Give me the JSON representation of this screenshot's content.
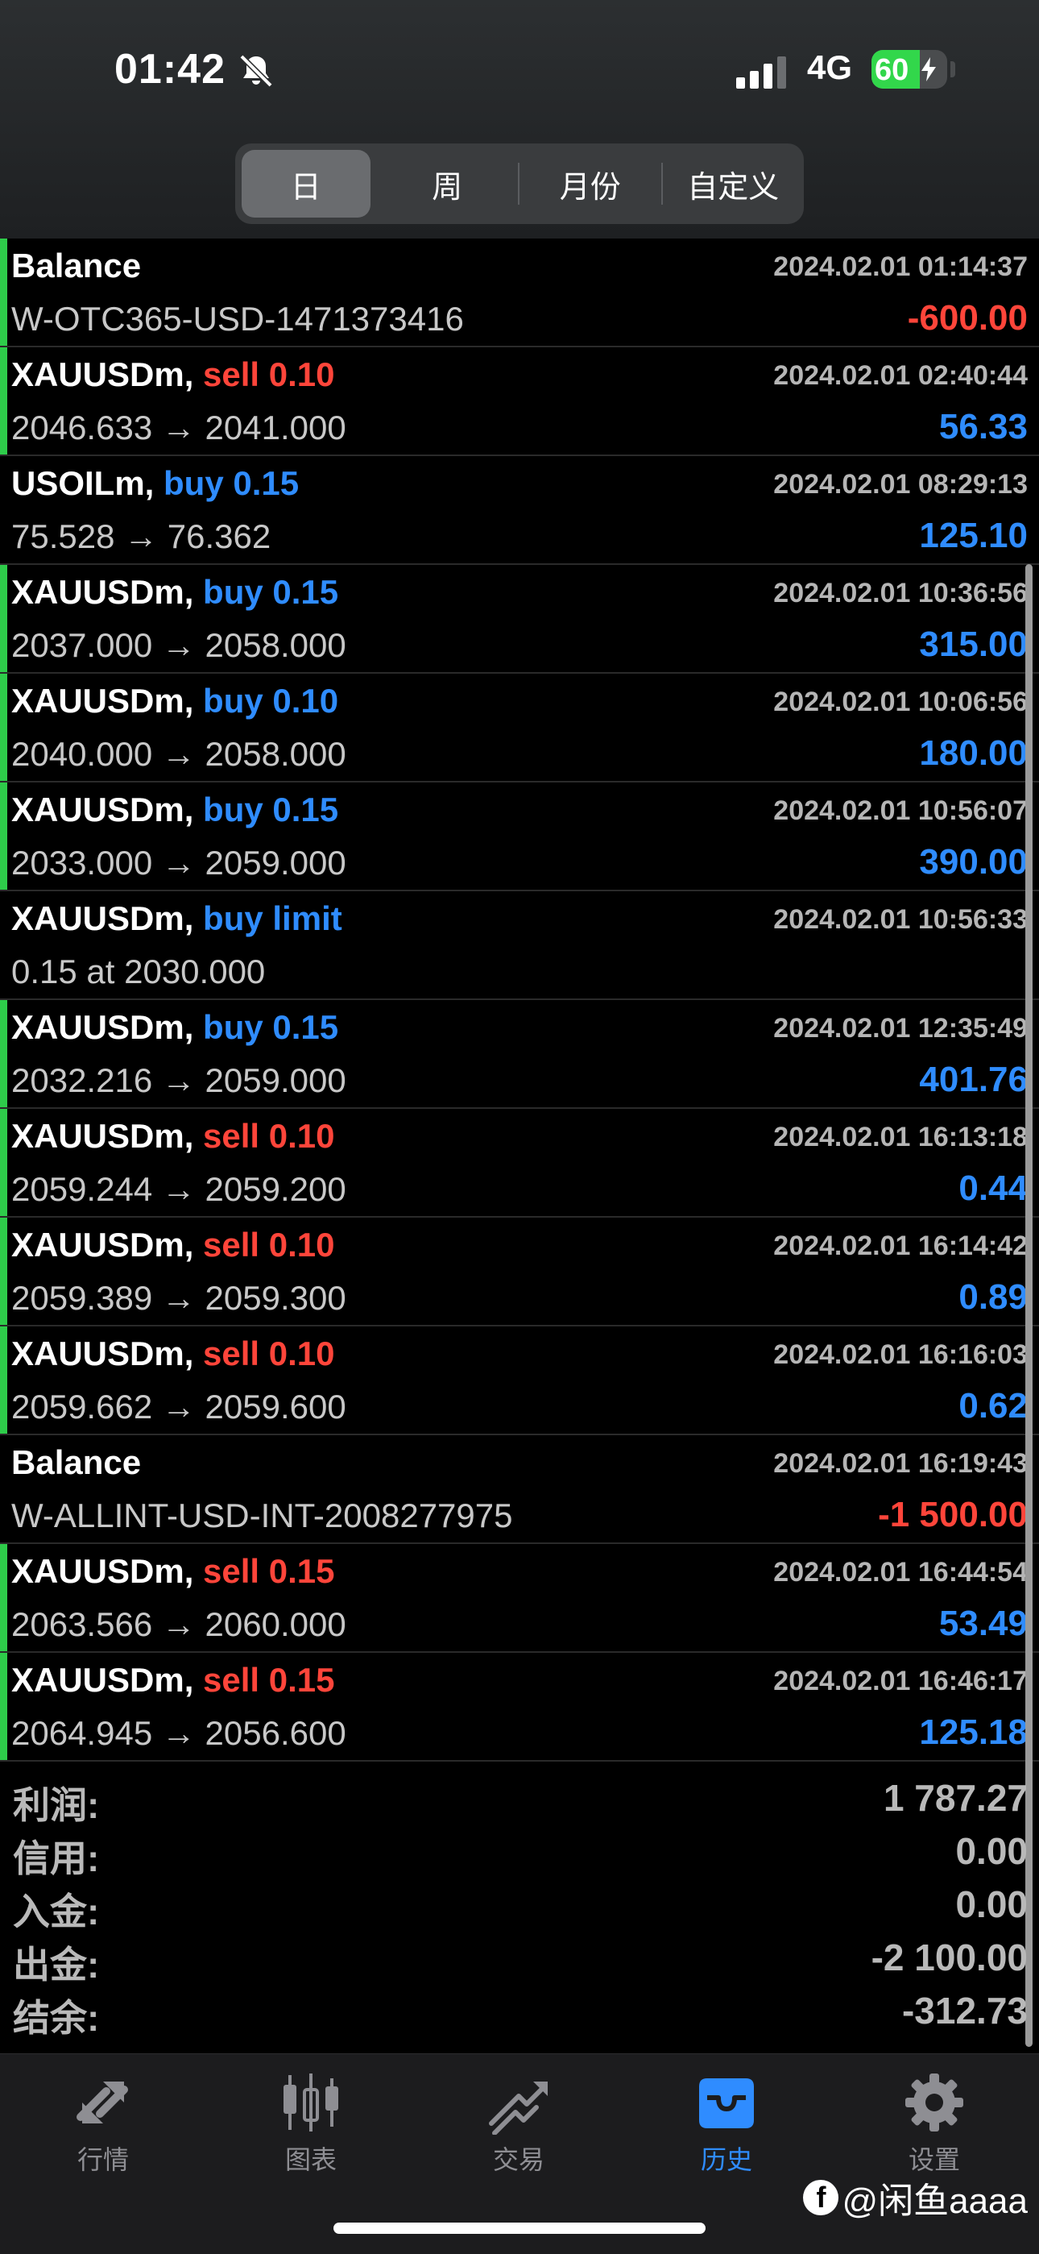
{
  "status": {
    "time": "01:42",
    "network": "4G",
    "battery": "60"
  },
  "segments": [
    {
      "label": "日",
      "active": true
    },
    {
      "label": "周",
      "active": false
    },
    {
      "label": "月份",
      "active": false
    },
    {
      "label": "自定义",
      "active": false
    }
  ],
  "rows": [
    {
      "symbol": "Balance",
      "type": "",
      "dir": "",
      "time": "2024.02.01 01:14:37",
      "sub": "W-OTC365-USD-1471373416",
      "amount": "-600.00",
      "sign": "neg",
      "bar": true
    },
    {
      "symbol": "XAUUSDm,",
      "type": "sell 0.10",
      "dir": "sell",
      "time": "2024.02.01 02:40:44",
      "sub": "2046.633 → 2041.000",
      "amount": "56.33",
      "sign": "pos",
      "bar": true
    },
    {
      "symbol": "USOILm,",
      "type": "buy 0.15",
      "dir": "buy",
      "time": "2024.02.01 08:29:13",
      "sub": "75.528 → 76.362",
      "amount": "125.10",
      "sign": "pos",
      "bar": false
    },
    {
      "symbol": "XAUUSDm,",
      "type": "buy 0.15",
      "dir": "buy",
      "time": "2024.02.01 10:36:56",
      "sub": "2037.000 → 2058.000",
      "amount": "315.00",
      "sign": "pos",
      "bar": true
    },
    {
      "symbol": "XAUUSDm,",
      "type": "buy 0.10",
      "dir": "buy",
      "time": "2024.02.01 10:06:56",
      "sub": "2040.000 → 2058.000",
      "amount": "180.00",
      "sign": "pos",
      "bar": true
    },
    {
      "symbol": "XAUUSDm,",
      "type": "buy 0.15",
      "dir": "buy",
      "time": "2024.02.01 10:56:07",
      "sub": "2033.000 → 2059.000",
      "amount": "390.00",
      "sign": "pos",
      "bar": true
    },
    {
      "symbol": "XAUUSDm,",
      "type": "buy limit",
      "dir": "buy",
      "time": "2024.02.01 10:56:33",
      "sub": "0.15 at 2030.000",
      "amount": "",
      "sign": "pos",
      "bar": false
    },
    {
      "symbol": "XAUUSDm,",
      "type": "buy 0.15",
      "dir": "buy",
      "time": "2024.02.01 12:35:49",
      "sub": "2032.216 → 2059.000",
      "amount": "401.76",
      "sign": "pos",
      "bar": true
    },
    {
      "symbol": "XAUUSDm,",
      "type": "sell 0.10",
      "dir": "sell",
      "time": "2024.02.01 16:13:18",
      "sub": "2059.244 → 2059.200",
      "amount": "0.44",
      "sign": "pos",
      "bar": true
    },
    {
      "symbol": "XAUUSDm,",
      "type": "sell 0.10",
      "dir": "sell",
      "time": "2024.02.01 16:14:42",
      "sub": "2059.389 → 2059.300",
      "amount": "0.89",
      "sign": "pos",
      "bar": true
    },
    {
      "symbol": "XAUUSDm,",
      "type": "sell 0.10",
      "dir": "sell",
      "time": "2024.02.01 16:16:03",
      "sub": "2059.662 → 2059.600",
      "amount": "0.62",
      "sign": "pos",
      "bar": true
    },
    {
      "symbol": "Balance",
      "type": "",
      "dir": "",
      "time": "2024.02.01 16:19:43",
      "sub": "W-ALLINT-USD-INT-2008277975",
      "amount": "-1 500.00",
      "sign": "neg",
      "bar": false
    },
    {
      "symbol": "XAUUSDm,",
      "type": "sell 0.15",
      "dir": "sell",
      "time": "2024.02.01 16:44:54",
      "sub": "2063.566 → 2060.000",
      "amount": "53.49",
      "sign": "pos",
      "bar": true
    },
    {
      "symbol": "XAUUSDm,",
      "type": "sell 0.15",
      "dir": "sell",
      "time": "2024.02.01 16:46:17",
      "sub": "2064.945 → 2056.600",
      "amount": "125.18",
      "sign": "pos",
      "bar": true
    }
  ],
  "summary": [
    {
      "label": "利润:",
      "value": "1 787.27"
    },
    {
      "label": "信用:",
      "value": "0.00"
    },
    {
      "label": "入金:",
      "value": "0.00"
    },
    {
      "label": "出金:",
      "value": "-2 100.00"
    },
    {
      "label": "结余:",
      "value": "-312.73"
    }
  ],
  "tabs": [
    {
      "label": "行情",
      "icon": "quotes-icon",
      "active": false
    },
    {
      "label": "图表",
      "icon": "chart-icon",
      "active": false
    },
    {
      "label": "交易",
      "icon": "trade-icon",
      "active": false
    },
    {
      "label": "历史",
      "icon": "history-icon",
      "active": true
    },
    {
      "label": "设置",
      "icon": "settings-icon",
      "active": false
    }
  ],
  "watermark": {
    "logo": "f",
    "text": "@闲鱼aaaa"
  },
  "colors": {
    "sell": "#ff453a",
    "buy": "#2f8cff",
    "bar": "#2ecc4a",
    "active_tab": "#2f8cff"
  }
}
